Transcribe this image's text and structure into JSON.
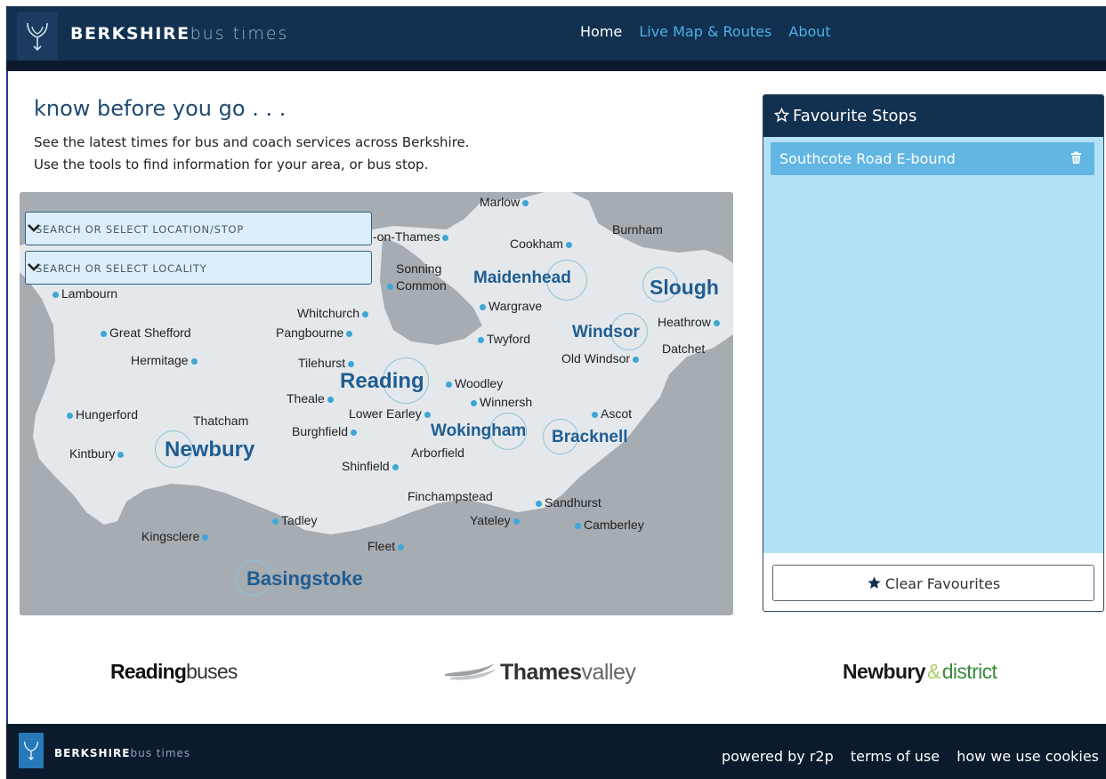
{
  "header": {
    "brand_bold": "BERKSHIRE",
    "brand_light": "bus times",
    "nav": [
      {
        "label": "Home",
        "active": true
      },
      {
        "label": "Live Map & Routes",
        "active": false
      },
      {
        "label": "About",
        "active": false
      }
    ]
  },
  "intro": {
    "heading": "know before you go . . .",
    "line1": "See the latest times for bus and coach services across Berkshire.",
    "line2": "Use the tools to find information for your area, or bus stop."
  },
  "search": {
    "location_placeholder": "SEARCH OR SELECT LOCATION/STOP",
    "locality_placeholder": "SEARCH OR SELECT LOCALITY"
  },
  "map": {
    "places": [
      "Marlow",
      "-on-Thames",
      "Cookham",
      "Burnham",
      "Sonning",
      "Common",
      "Lambourn",
      "Whitchurch",
      "Wargrave",
      "Heathrow",
      "Great Shefford",
      "Pangbourne",
      "Twyford",
      "Datchet",
      "Hermitage",
      "Tilehurst",
      "Old Windsor",
      "Woodley",
      "Theale",
      "Winnersh",
      "Hungerford",
      "Thatcham",
      "Lower Earley",
      "Ascot",
      "Burghfield",
      "Kintbury",
      "Arborfield",
      "Shinfield",
      "Finchampstead",
      "Sandhurst",
      "Tadley",
      "Yateley",
      "Camberley",
      "Kingsclere",
      "Fleet"
    ],
    "towns": [
      "Maidenhead",
      "Slough",
      "Windsor",
      "Reading",
      "Wokingham",
      "Bracknell",
      "Newbury",
      "Basingstoke"
    ],
    "colors": {
      "land": "#e4e8eb",
      "water": "#a5acb2",
      "dot": "#3ea6d6",
      "town": "#1f5d92"
    }
  },
  "favourites": {
    "title": "Favourite Stops",
    "items": [
      "Southcote Road E-bound"
    ],
    "clear_label": "Clear Favourites"
  },
  "operators": {
    "reading_bold": "Reading",
    "reading_light": "buses",
    "thames_bold": "Thames",
    "thames_light": "valley",
    "newbury_bold": "Newbury",
    "newbury_amp": "&",
    "newbury_light": "district"
  },
  "footer": {
    "brand_bold": "BERKSHIRE",
    "brand_light": "bus times",
    "links": [
      "powered by r2p",
      "terms of use",
      "how we use cookies"
    ]
  }
}
